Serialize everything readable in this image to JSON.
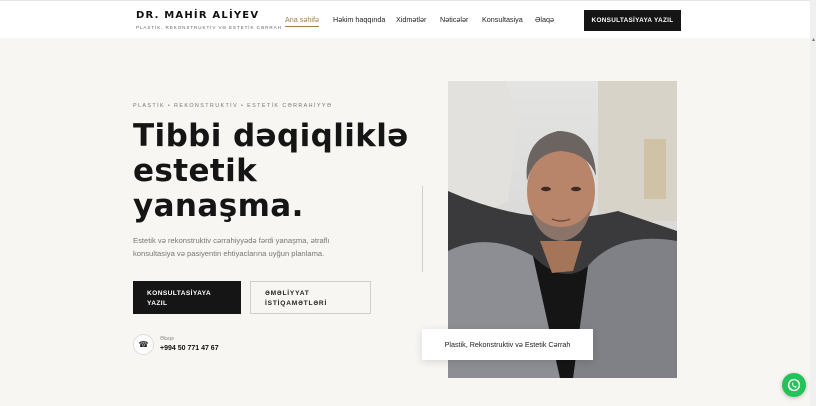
{
  "header": {
    "brand_name": "DR. MAHİR ALİYEV",
    "brand_subtitle": "PLASTİK, REKONSTRUKTİV VƏ ESTETİK CƏRRAH",
    "nav": [
      {
        "label": "Ana səhifə",
        "active": true
      },
      {
        "label": "Həkim haqqında",
        "active": false
      },
      {
        "label": "Xidmətlər",
        "active": false
      },
      {
        "label": "Nəticələr",
        "active": false
      },
      {
        "label": "Konsultasiya",
        "active": false
      },
      {
        "label": "Əlaqə",
        "active": false
      }
    ],
    "cta_label": "KONSULTASİYAYA YAZIL"
  },
  "hero": {
    "eyebrow": "PLASTİK • REKONSTRUKTİV • ESTETİK CƏRRAHİYYƏ",
    "headline": [
      "Tibbi dəqiqliklə",
      "estetik",
      "yanaşma."
    ],
    "lead": "Estetik və rekonstruktiv cərrahiyyədə fərdi yanaşma, ətraflı konsultasiya və pasiyentin ehtiyaclarına uyğun planlama.",
    "primary_button": "KONSULTASİYAYA YAZIL",
    "secondary_button": "ƏMƏLİYYAT İSTİQAMƏTLƏRİ",
    "phone_label": "Əlaqə",
    "phone_number": "+994 50 771 47 67"
  },
  "portrait": {
    "caption": "Plastik, Rekonstruktiv və Estetik Cərrah"
  },
  "icons": {
    "phone": "phone-icon",
    "whatsapp": "whatsapp-icon"
  },
  "colors": {
    "accent": "#a07c4e",
    "dark": "#151515",
    "background": "#f7f6f3",
    "whatsapp": "#25c25a"
  }
}
